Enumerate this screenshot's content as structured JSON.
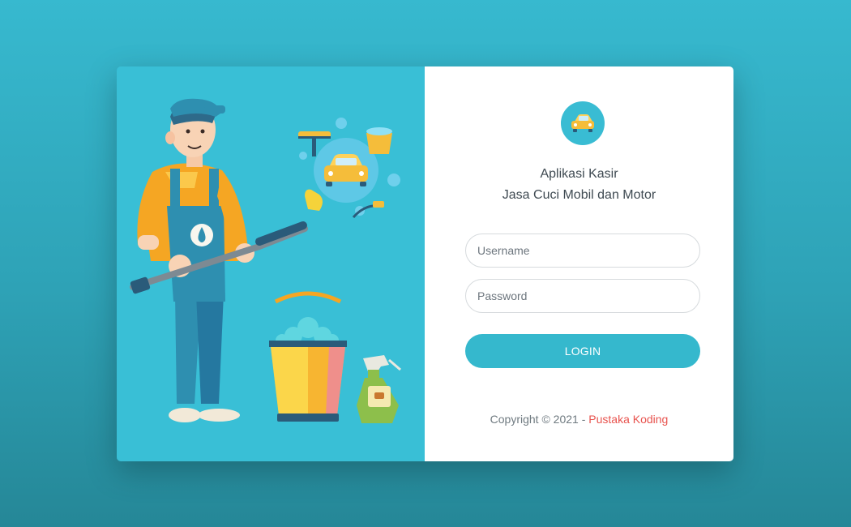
{
  "app": {
    "title_line1": "Aplikasi Kasir",
    "title_line2": "Jasa Cuci Mobil dan Motor",
    "logo_icon": "car-icon"
  },
  "form": {
    "username_placeholder": "Username",
    "username_value": "",
    "password_placeholder": "Password",
    "password_value": "",
    "login_label": "LOGIN"
  },
  "footer": {
    "copyright_text": "Copyright © 2021 - ",
    "link_label": "Pustaka Koding"
  },
  "colors": {
    "accent": "#35b8cd",
    "illustration_bg": "#39bfd6",
    "link": "#e8534e"
  },
  "illustration": {
    "name": "car-wash-worker-illustration",
    "icons": [
      "car-icon",
      "bucket-icon",
      "spray-bottle-icon",
      "squeegee-icon",
      "glove-icon",
      "sponge-icon"
    ]
  }
}
